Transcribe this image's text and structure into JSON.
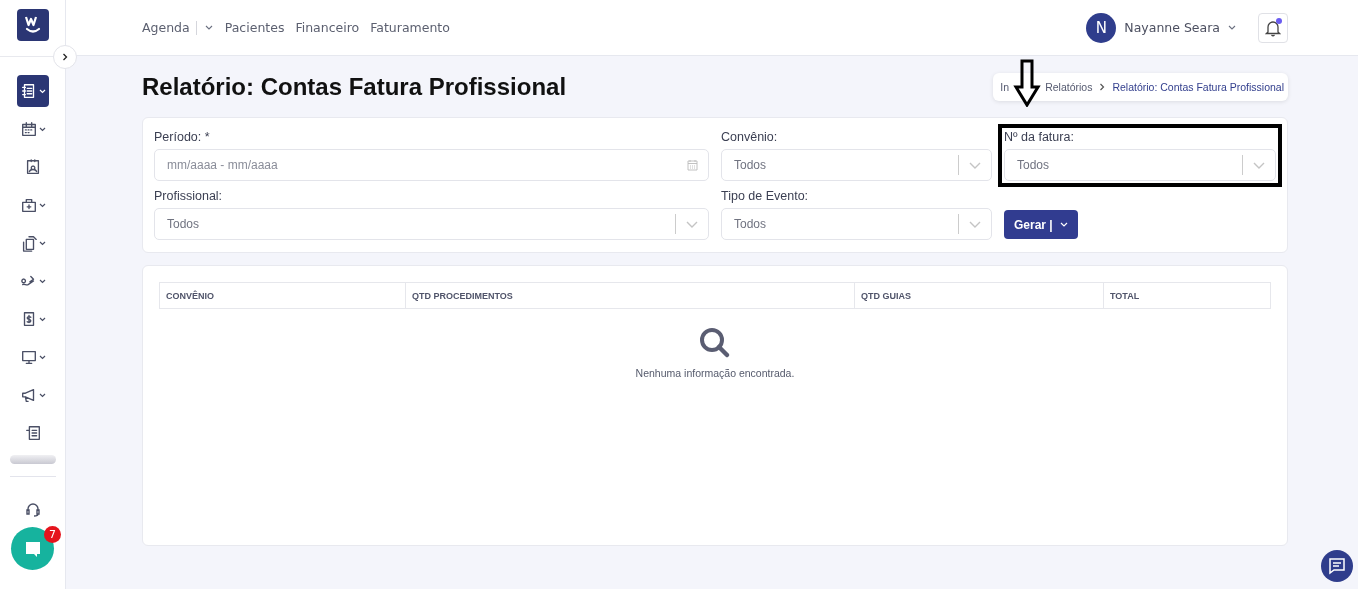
{
  "sidebar": {
    "items": [
      {
        "selected": true,
        "expandable": true
      },
      {
        "selected": false,
        "expandable": true
      },
      {
        "selected": false,
        "expandable": false
      },
      {
        "selected": false,
        "expandable": true
      },
      {
        "selected": false,
        "expandable": true
      },
      {
        "selected": false,
        "expandable": true
      },
      {
        "selected": false,
        "expandable": true
      },
      {
        "selected": false,
        "expandable": true
      },
      {
        "selected": false,
        "expandable": true
      },
      {
        "selected": false,
        "expandable": false
      }
    ],
    "chat_badge": "7"
  },
  "nav": [
    {
      "label": "Agenda",
      "dropdown": true
    },
    {
      "label": "Pacientes",
      "dropdown": false
    },
    {
      "label": "Financeiro",
      "dropdown": false
    },
    {
      "label": "Faturamento",
      "dropdown": false
    }
  ],
  "user": {
    "initial": "N",
    "name": "Nayanne Seara"
  },
  "notifications": {
    "unread": true
  },
  "page": {
    "title": "Relatório: Contas Fatura Profissional",
    "breadcrumb": [
      "In",
      "Relatórios",
      "Relatório: Contas Fatura Profissional"
    ]
  },
  "filters": [
    {
      "kind": "date",
      "label": "Período: *",
      "placeholder": "mm/aaaa - mm/aaaa",
      "highlighted": false
    },
    {
      "kind": "select",
      "label": "Convênio:",
      "value": "Todos",
      "highlighted": false
    },
    {
      "kind": "select",
      "label": "Nº da fatura:",
      "value": "Todos",
      "highlighted": true
    },
    {
      "kind": "select",
      "label": "Profissional:",
      "value": "Todos",
      "highlighted": false
    },
    {
      "kind": "select",
      "label": "Tipo de Evento:",
      "value": "Todos",
      "highlighted": false
    }
  ],
  "generate_button": "Gerar |",
  "table": {
    "columns": [
      "CONVÊNIO",
      "QTD PROCEDIMENTOS",
      "QTD GUIAS",
      "TOTAL"
    ],
    "empty_message": "Nenhuma informação encontrada."
  }
}
